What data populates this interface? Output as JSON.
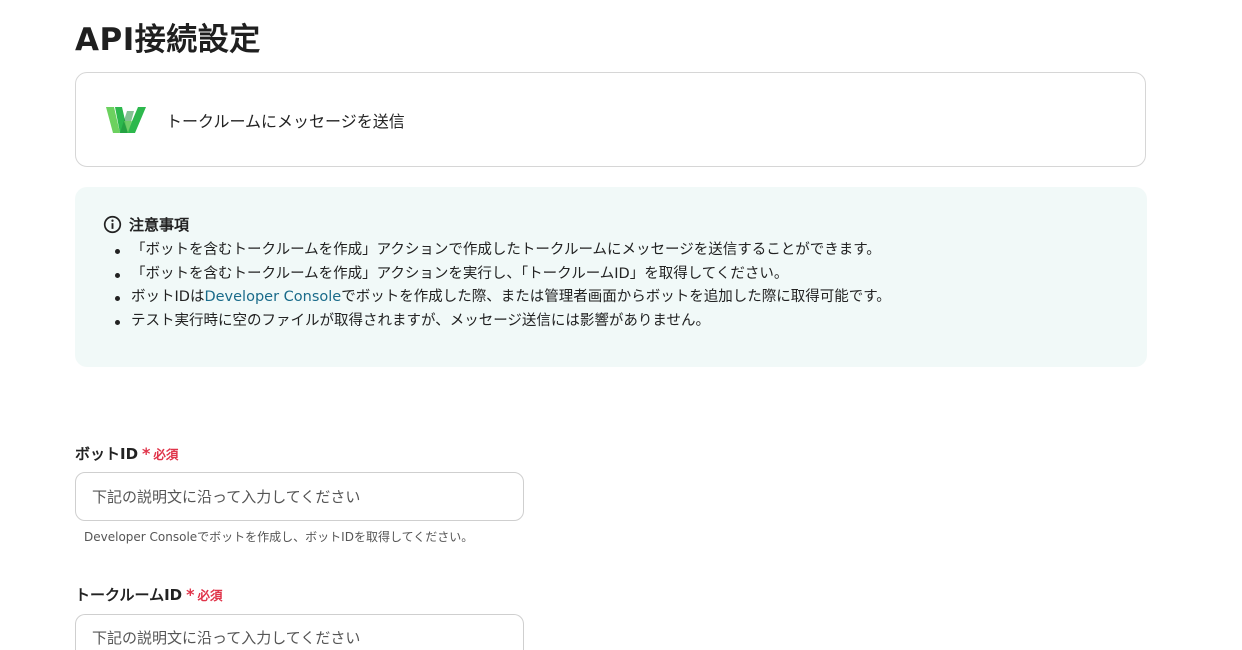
{
  "page": {
    "title": "API接続設定"
  },
  "action": {
    "label": "トークルームにメッセージを送信",
    "logo_colors": [
      "#2db84d",
      "#6cd15f",
      "#1f8f3a"
    ]
  },
  "notice": {
    "heading": "注意事項",
    "items": {
      "0": "「ボットを含むトークルームを作成」アクションで作成したトークルームにメッセージを送信することができます。",
      "1": "「ボットを含むトークルームを作成」アクションを実行し、「トークルームID」を取得してください。",
      "2_prefix": "ボットIDは",
      "2_link": "Developer Console",
      "2_suffix": "でボットを作成した際、または管理者画面からボットを追加した際に取得可能です。",
      "3": "テスト実行時に空のファイルが取得されますが、メッセージ送信には影響がありません。"
    },
    "background": "#f1f9f8"
  },
  "fields": {
    "bot_id": {
      "label": "ボットID",
      "required_mark": "*",
      "required_text": "必須",
      "placeholder": "下記の説明文に沿って入力してください",
      "value": "",
      "help": "Developer Consoleでボットを作成し、ボットIDを取得してください。"
    },
    "room_id": {
      "label": "トークルームID",
      "required_mark": "*",
      "required_text": "必須",
      "placeholder": "下記の説明文に沿って入力してください",
      "value": ""
    }
  },
  "colors": {
    "required": "#e0344a",
    "link": "#1a6b8a"
  }
}
